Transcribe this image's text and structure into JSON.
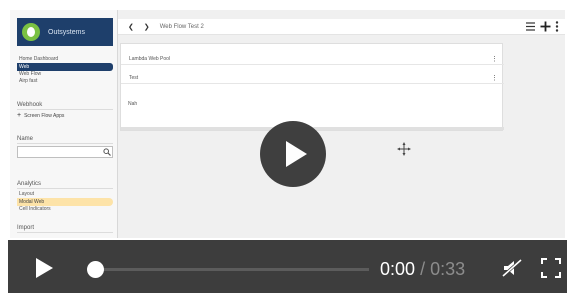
{
  "sidebar": {
    "logo_text": "Outsystems",
    "nav_items": [
      {
        "label": "Home Dashboard",
        "selected": false
      },
      {
        "label": "Web",
        "selected": true
      },
      {
        "label": "Web Flow",
        "selected": false
      },
      {
        "label": "Airp fast",
        "selected": false
      }
    ],
    "section_webhook": "Webhook",
    "add_webhook_label": "Screen Flow Apps",
    "section_search": "Name",
    "section_analytics": "Analytics",
    "analytics_items": [
      {
        "label": "Layout",
        "highlight": false
      },
      {
        "label": "Modal Web",
        "highlight": true
      },
      {
        "label": "Cell Indicators",
        "highlight": false
      }
    ],
    "section_import": "Import"
  },
  "topbar": {
    "nav_arrows": "❮ ❯",
    "title": "Web Flow Test 2"
  },
  "panel": {
    "row1_label": "Lambda Web Pool",
    "row2_label": "Test",
    "body_text": "Nah"
  },
  "video": {
    "current_time": "0:00",
    "separator": "/",
    "duration": "0:33",
    "progress": 0
  },
  "colors": {
    "brand_navy": "#1e3f6b",
    "brand_green": "#7ac143",
    "highlight": "#fde3a8",
    "control_bar": "#3d3d3d"
  },
  "icons": [
    "logo-icon",
    "search-icon",
    "list-icon",
    "add-icon",
    "more-icon",
    "play-icon",
    "cursor-crosshair-icon",
    "muted-speaker-icon",
    "fullscreen-icon"
  ]
}
